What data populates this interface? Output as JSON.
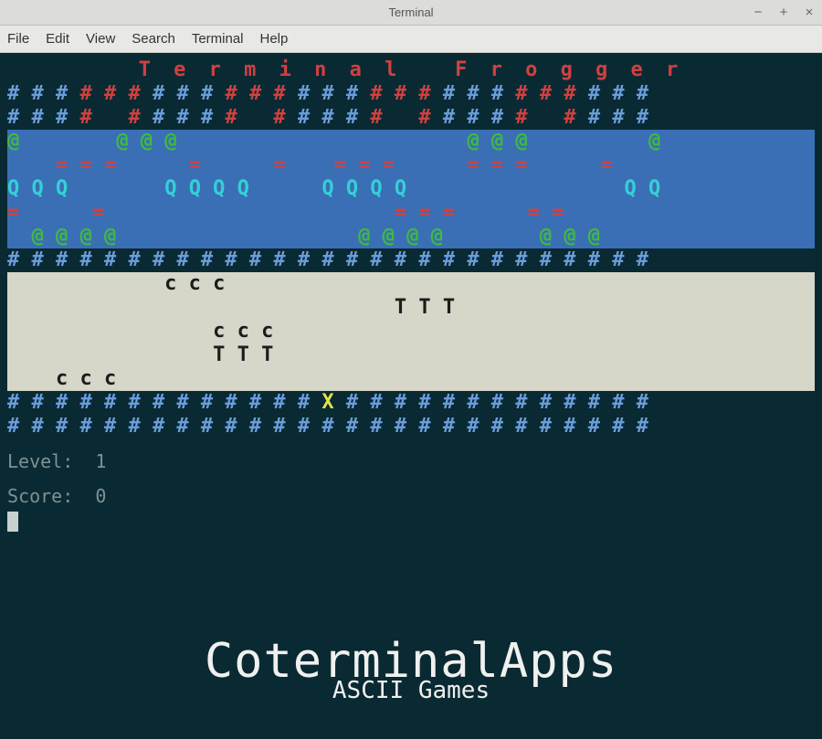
{
  "window": {
    "title": "Terminal"
  },
  "window_controls": {
    "min": "−",
    "max": "+",
    "close": "×"
  },
  "menubar": [
    "File",
    "Edit",
    "View",
    "Search",
    "Terminal",
    "Help"
  ],
  "game": {
    "title": "T e r m i n a l   F r o g g e r",
    "rows": {
      "bank_top_1": [
        {
          "t": "# # # ",
          "c": "blue"
        },
        {
          "t": "# # # ",
          "c": "red"
        },
        {
          "t": "# # # ",
          "c": "blue"
        },
        {
          "t": "# # # ",
          "c": "red"
        },
        {
          "t": "# # # ",
          "c": "blue"
        },
        {
          "t": "# # # ",
          "c": "red"
        },
        {
          "t": "# # # ",
          "c": "blue"
        },
        {
          "t": "# # # ",
          "c": "red"
        },
        {
          "t": "# # #",
          "c": "blue"
        }
      ],
      "bank_top_2": [
        {
          "t": "# # # ",
          "c": "blue"
        },
        {
          "t": "#   # ",
          "c": "red"
        },
        {
          "t": "# # # ",
          "c": "blue"
        },
        {
          "t": "#   # ",
          "c": "red"
        },
        {
          "t": "# # # ",
          "c": "blue"
        },
        {
          "t": "#   # ",
          "c": "red"
        },
        {
          "t": "# # # ",
          "c": "blue"
        },
        {
          "t": "#   # ",
          "c": "red"
        },
        {
          "t": "# # #",
          "c": "blue"
        }
      ],
      "water_1": [
        {
          "t": "@",
          "c": "green"
        },
        {
          "t": "        ",
          "c": "green"
        },
        {
          "t": "@ @ @",
          "c": "green"
        },
        {
          "t": "                        ",
          "c": "green"
        },
        {
          "t": "@ @ @",
          "c": "green"
        },
        {
          "t": "          ",
          "c": "green"
        },
        {
          "t": "@",
          "c": "green"
        }
      ],
      "water_2": [
        {
          "t": "    ",
          "c": "red"
        },
        {
          "t": "= = =",
          "c": "red"
        },
        {
          "t": "      ",
          "c": "red"
        },
        {
          "t": "=",
          "c": "red"
        },
        {
          "t": "      ",
          "c": "red"
        },
        {
          "t": "=",
          "c": "red"
        },
        {
          "t": "    ",
          "c": "red"
        },
        {
          "t": "= = =",
          "c": "red"
        },
        {
          "t": "      ",
          "c": "red"
        },
        {
          "t": "= = =",
          "c": "red"
        },
        {
          "t": "      ",
          "c": "red"
        },
        {
          "t": "=",
          "c": "red"
        }
      ],
      "water_3": [
        {
          "t": "Q Q Q",
          "c": "cyan"
        },
        {
          "t": "        ",
          "c": "cyan"
        },
        {
          "t": "Q Q Q Q",
          "c": "cyan"
        },
        {
          "t": "      ",
          "c": "cyan"
        },
        {
          "t": "Q Q Q Q",
          "c": "cyan"
        },
        {
          "t": "                  ",
          "c": "cyan"
        },
        {
          "t": "Q Q",
          "c": "cyan"
        }
      ],
      "water_4": [
        {
          "t": "=",
          "c": "red"
        },
        {
          "t": "      ",
          "c": "red"
        },
        {
          "t": "=",
          "c": "red"
        },
        {
          "t": "                        ",
          "c": "red"
        },
        {
          "t": "= = =",
          "c": "red"
        },
        {
          "t": "      ",
          "c": "red"
        },
        {
          "t": "= =",
          "c": "red"
        }
      ],
      "water_5": [
        {
          "t": "  ",
          "c": "green"
        },
        {
          "t": "@ @ @ @",
          "c": "green"
        },
        {
          "t": "                    ",
          "c": "green"
        },
        {
          "t": "@ @ @ @",
          "c": "green"
        },
        {
          "t": "        ",
          "c": "green"
        },
        {
          "t": "@ @ @",
          "c": "green"
        }
      ],
      "median": [
        {
          "t": "# # # # # # # # # # # # # # # # # # # # # # # # # # #",
          "c": "blue"
        }
      ],
      "road_1": [
        {
          "t": "             c c c",
          "c": "black"
        }
      ],
      "road_2": [
        {
          "t": "                                T T T",
          "c": "black"
        }
      ],
      "road_3": [
        {
          "t": "                 c c c",
          "c": "black"
        }
      ],
      "road_4": [
        {
          "t": "                 T T T",
          "c": "black"
        }
      ],
      "road_5": [
        {
          "t": "    c c c",
          "c": "black"
        }
      ],
      "start_1": [
        {
          "t": "# # # # # # # # # # # # # ",
          "c": "blue"
        },
        {
          "t": "X",
          "c": "yellow"
        },
        {
          "t": " # # # # # # # # # # # # #",
          "c": "blue"
        }
      ],
      "start_2": [
        {
          "t": "# # # # # # # # # # # # # # # # # # # # # # # # # # #",
          "c": "blue"
        }
      ]
    },
    "status": {
      "level_label": "Level:",
      "level": "1",
      "score_label": "Score:",
      "score": "0"
    }
  },
  "overlay": {
    "title": "CoterminalApps",
    "subtitle": "ASCII Games"
  }
}
